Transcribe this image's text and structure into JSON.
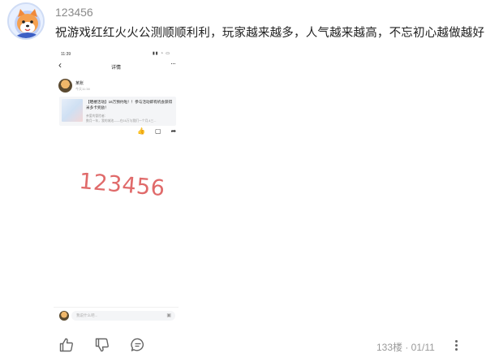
{
  "post": {
    "username": "123456",
    "text": "祝游戏红红火火公测顺顺利利，玩家越来越多，人气越来越高，不忘初心越做越好"
  },
  "screenshot": {
    "status_time": "11:39",
    "status_icons": "▮▮ ◔ ▭",
    "back_glyph": "‹",
    "title": "详情",
    "more_glyph": "···",
    "author_name": "某账",
    "author_time": "今天11:38",
    "card_title": "【晒楼活动】16万预约啦！！参与活动即有机会获得米多卡奖励！",
    "card_line1": "亲爱的冒险者：",
    "card_line2": "数月一年，我的城池——在16万与我们一个月,4三...",
    "actions": [
      "👍",
      "▢",
      "➦"
    ],
    "watermark": "123456",
    "input_placeholder": "我说什么吧...",
    "input_icon": "▣"
  },
  "footer": {
    "floor_label": "133楼 · 01/11"
  },
  "icons": {
    "like": "thumbs-up-icon",
    "dislike": "thumbs-down-icon",
    "comment": "comment-icon",
    "more": "more-vertical-icon"
  }
}
